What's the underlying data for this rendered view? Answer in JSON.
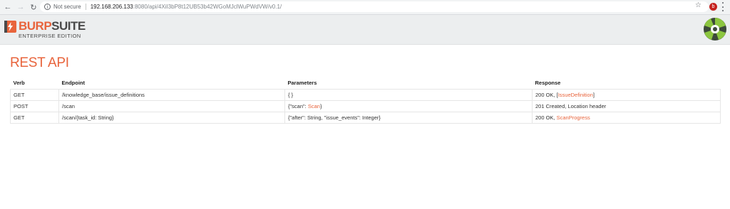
{
  "browser": {
    "security_label": "Not secure",
    "url_host": "192.168.206.133",
    "url_path": ":8080/api/4XiI3bP8t12UB53b42WGoMJclWuPWdVW/v0.1/",
    "profile_initial": "b"
  },
  "app": {
    "logo_burp": "BURP",
    "logo_suite": "SUITE",
    "logo_subtitle": "ENTERPRISE EDITION"
  },
  "page": {
    "title": "REST API"
  },
  "table": {
    "headers": {
      "verb": "Verb",
      "endpoint": "Endpoint",
      "parameters": "Parameters",
      "response": "Response"
    },
    "rows": [
      {
        "verb": "GET",
        "endpoint": "/knowledge_base/issue_definitions",
        "params_text": "{ }",
        "response_prefix": "200 OK, [",
        "response_link": "IssueDefinition",
        "response_suffix": "]"
      },
      {
        "verb": "POST",
        "endpoint": "/scan",
        "params_prefix": "{\"scan\": ",
        "params_link": "Scan",
        "params_suffix": "}",
        "response_text": "201 Created, Location header"
      },
      {
        "verb": "GET",
        "endpoint": "/scan/{task_id: String}",
        "params_text": "{\"after\": String, \"issue_events\": Integer}",
        "response_prefix": "200 OK, ",
        "response_link": "ScanProgress"
      }
    ]
  },
  "colors": {
    "accent": "#e8643c",
    "header_bg": "#eceeef"
  }
}
